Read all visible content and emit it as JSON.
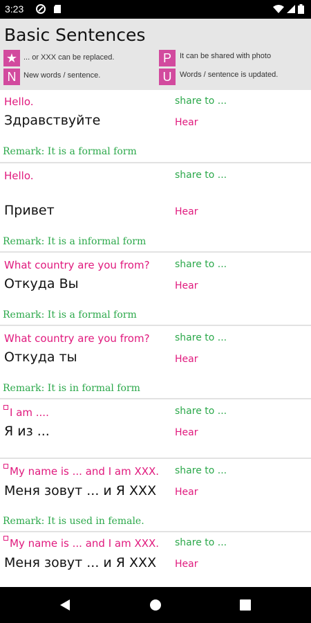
{
  "status_bar": {
    "time": "3:23"
  },
  "header": {
    "title": "Basic Sentences",
    "legend": [
      {
        "badge": "★",
        "text": "... or XXX can be replaced."
      },
      {
        "badge": "P",
        "text": "It can be shared with photo"
      },
      {
        "badge": "N",
        "text": "New words / sentence."
      },
      {
        "badge": "U",
        "text": "Words / sentence is updated."
      }
    ]
  },
  "colors": {
    "accent": "#e0197d",
    "badge": "#d24a9e",
    "green": "#2ba84a"
  },
  "list": {
    "share_label": "share to ...",
    "hear_label": "Hear",
    "items": [
      {
        "english": "Hello.",
        "russian": "Здравствуйте",
        "remark": "Remark: It is a formal form"
      },
      {
        "english": "Hello.",
        "russian": "Привет",
        "remark": "Remark: It is a informal form"
      },
      {
        "english": "What country are you from?",
        "russian": "Откуда Вы",
        "remark": "Remark: It is a formal form"
      },
      {
        "english": "What country are you from?",
        "russian": "Откуда ты",
        "remark": "Remark: It is in formal form"
      },
      {
        "english": "I am ....",
        "russian": "Я из ...",
        "remark": ""
      },
      {
        "english": "My name is ... and I am XXX.",
        "russian": "Меня зовут ... и Я XXX",
        "remark": "Remark: It is used in female."
      },
      {
        "english": "My name is ... and I am XXX.",
        "russian": "Меня зовут ... и Я XXX",
        "remark": ""
      }
    ]
  }
}
